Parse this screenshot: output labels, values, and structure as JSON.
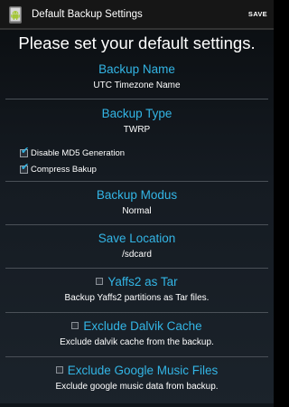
{
  "action_bar": {
    "title": "Default Backup Settings",
    "save_label": "SAVE",
    "app_icon": "android-icon"
  },
  "heading": "Please set your default settings.",
  "backup_name": {
    "label": "Backup Name",
    "value": "UTC Timezone Name"
  },
  "backup_type": {
    "label": "Backup Type",
    "value": "TWRP"
  },
  "options": [
    {
      "label": "Disable MD5 Generation",
      "checked": true
    },
    {
      "label": "Compress Bakup",
      "checked": true
    }
  ],
  "backup_modus": {
    "label": "Backup Modus",
    "value": "Normal"
  },
  "save_location": {
    "label": "Save Location",
    "value": "/sdcard"
  },
  "yaffs2": {
    "label": "Yaffs2 as Tar",
    "description": "Backup Yaffs2 partitions as Tar files.",
    "checked": false
  },
  "dalvik": {
    "label": "Exclude Dalvik Cache",
    "description": "Exclude dalvik cache from the backup.",
    "checked": false
  },
  "google_music": {
    "label": "Exclude Google Music Files",
    "description": "Exclude google music data from backup.",
    "checked": false
  },
  "colors": {
    "accent": "#33b5e5",
    "action_bar": "#161616",
    "android_green": "#a4c639"
  }
}
